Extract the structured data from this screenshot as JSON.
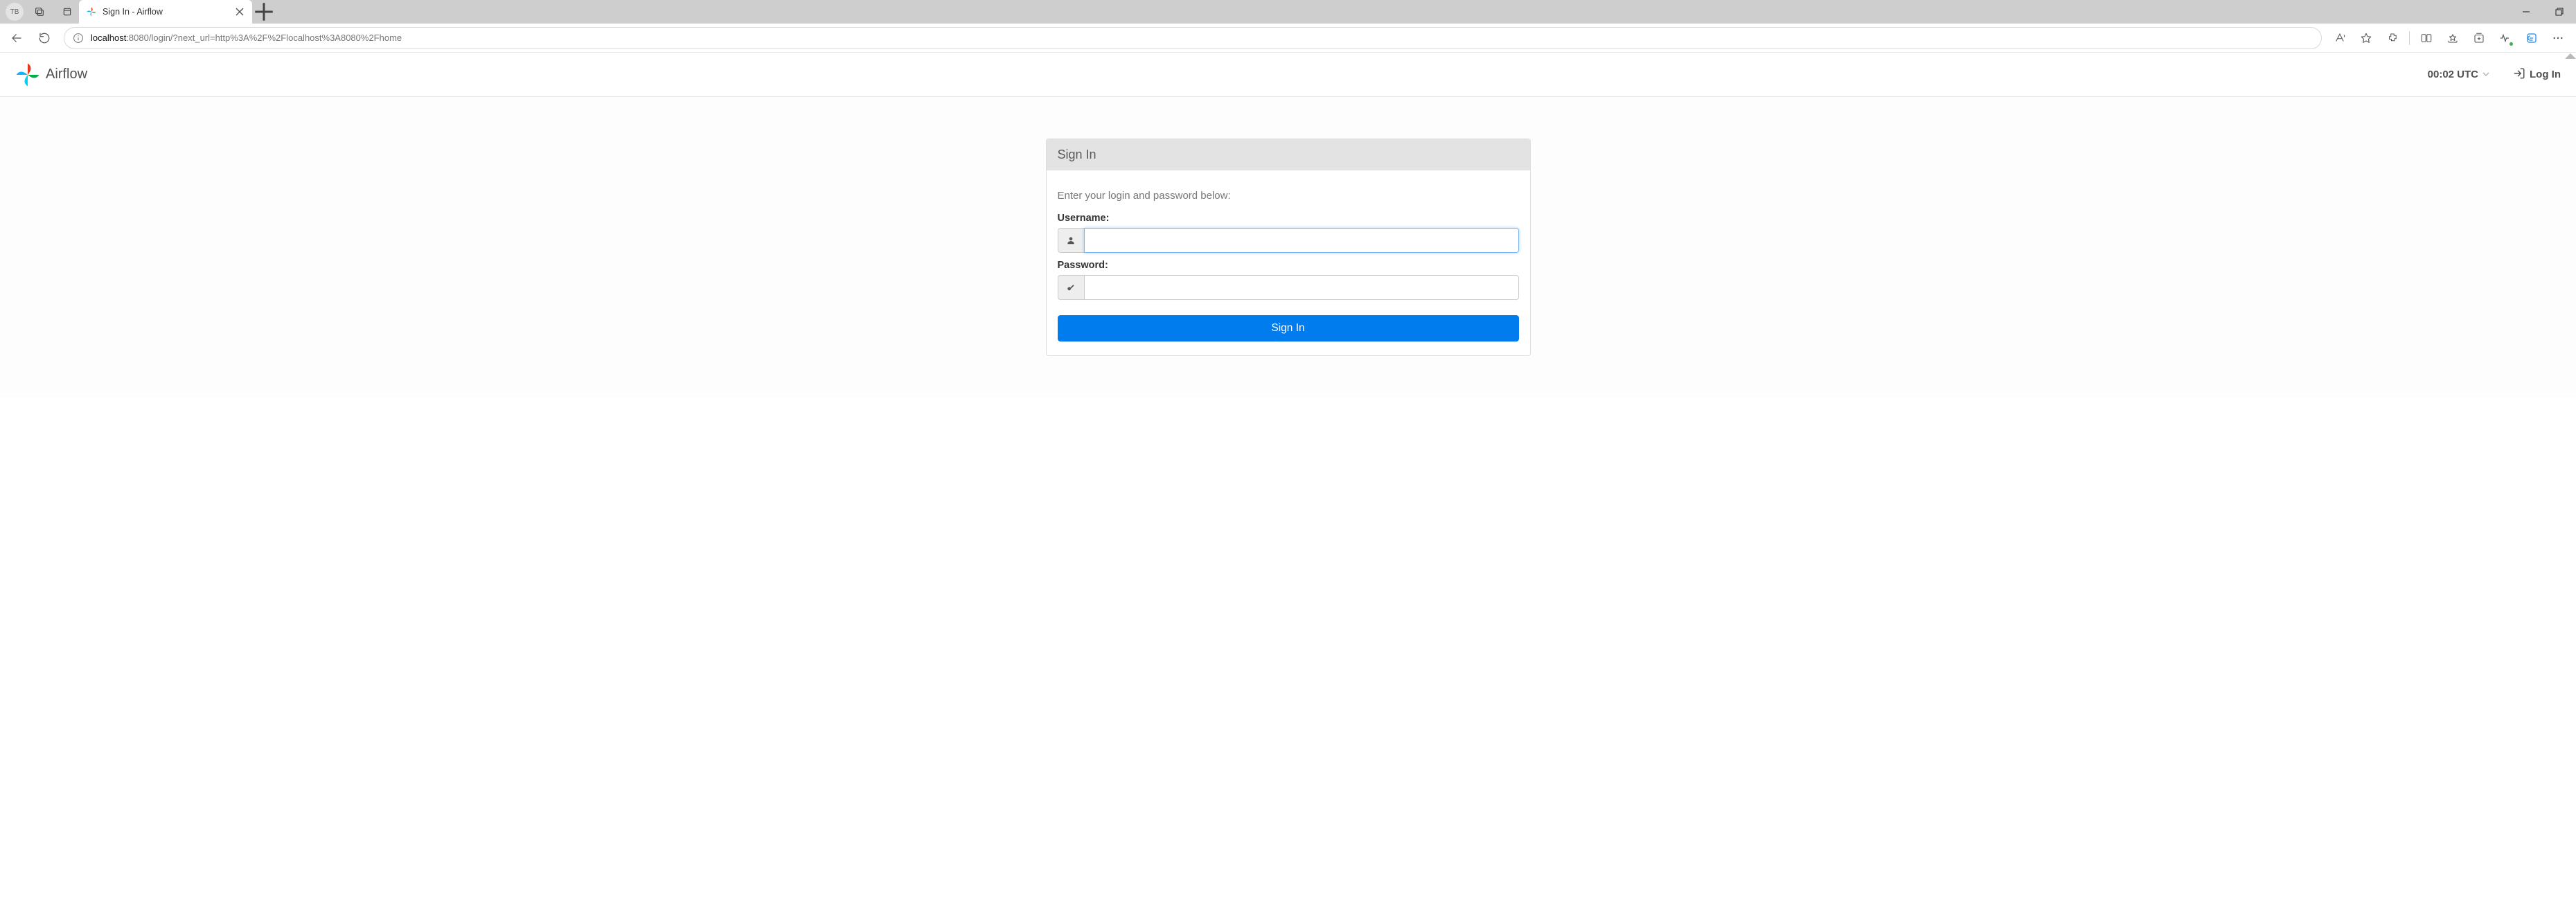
{
  "browser": {
    "profile_initials": "TB",
    "tab": {
      "title": "Sign In - Airflow"
    },
    "url_display_host": "localhost",
    "url_display_rest": ":8080/login/?next_url=http%3A%2F%2Flocalhost%3A8080%2Fhome"
  },
  "navbar": {
    "brand": "Airflow",
    "time": "00:02 UTC",
    "login_link": "Log In"
  },
  "login_panel": {
    "heading": "Sign In",
    "help": "Enter your login and password below:",
    "username_label": "Username:",
    "password_label": "Password:",
    "username_value": "",
    "password_value": "",
    "submit_label": "Sign In"
  }
}
